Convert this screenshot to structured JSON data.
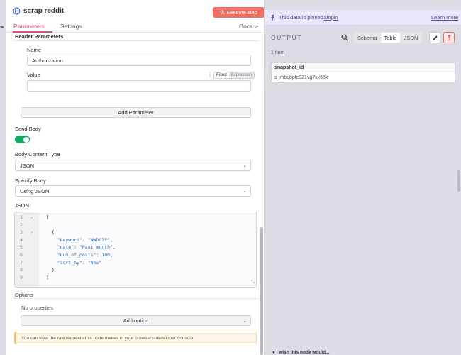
{
  "node": {
    "title": "scrap reddit",
    "execute_label": "Execute step",
    "tabs": [
      {
        "label": "Parameters"
      },
      {
        "label": "Settings"
      }
    ],
    "docs_label": "Docs"
  },
  "params": {
    "header_parameters_label": "Header Parameters",
    "name_label": "Name",
    "name_value": "Authorization",
    "value_label": "Value",
    "value_value": "",
    "fixed_label": "Fixed",
    "expression_label": "Expression",
    "add_parameter_label": "Add Parameter",
    "send_body_label": "Send Body",
    "send_body_enabled": true,
    "body_content_type_label": "Body Content Type",
    "body_content_type_value": "JSON",
    "specify_body_label": "Specify Body",
    "specify_body_value": "Using JSON",
    "json_label": "JSON",
    "json_lines": [
      {
        "n": "1",
        "fold": true,
        "text": "["
      },
      {
        "n": "2",
        "fold": false,
        "text": ""
      },
      {
        "n": "3",
        "fold": true,
        "text": "  {"
      },
      {
        "n": "4",
        "fold": false,
        "key": "\"keyword\"",
        "val": "\"WWDC25\"",
        "trail": ","
      },
      {
        "n": "5",
        "fold": false,
        "key": "\"date\"",
        "val": "\"Past month\"",
        "trail": ","
      },
      {
        "n": "6",
        "fold": false,
        "key": "\"num_of_posts\"",
        "val": "100",
        "trail": ","
      },
      {
        "n": "7",
        "fold": false,
        "key": "\"sort_by\"",
        "val": "\"New\"",
        "trail": ""
      },
      {
        "n": "8",
        "fold": false,
        "text": "  }"
      },
      {
        "n": "9",
        "fold": false,
        "text": "]"
      }
    ],
    "options_label": "Options",
    "no_properties_label": "No properties",
    "add_option_label": "Add option",
    "hint_text": "You can view the raw requests this node makes in your browser's developer console"
  },
  "output": {
    "pinned_text": "This data is pinned.",
    "unpin_label": "Unpin",
    "learn_more_label": "Learn more",
    "title": "OUTPUT",
    "views": [
      {
        "label": "Schema",
        "active": false
      },
      {
        "label": "Table",
        "active": true
      },
      {
        "label": "JSON",
        "active": false
      }
    ],
    "item_count": "1 item",
    "table": {
      "columns": [
        "snapshot_id"
      ],
      "rows": [
        [
          "s_mbubple921vg7kk65x"
        ]
      ]
    },
    "bottom_text": "I wish this node would..."
  },
  "colors": {
    "accent": "#ea4b71",
    "execute": "#f26e60",
    "toggle_on": "#11a85f",
    "pinned_bg": "#e9e5fb",
    "pin_active": "#f26e60"
  },
  "icons": {
    "node": "globe-icon",
    "docs": "external-link-icon",
    "pin": "pin-icon",
    "search": "search-icon",
    "edit": "pencil-icon",
    "pin_toggle": "pin-icon"
  }
}
